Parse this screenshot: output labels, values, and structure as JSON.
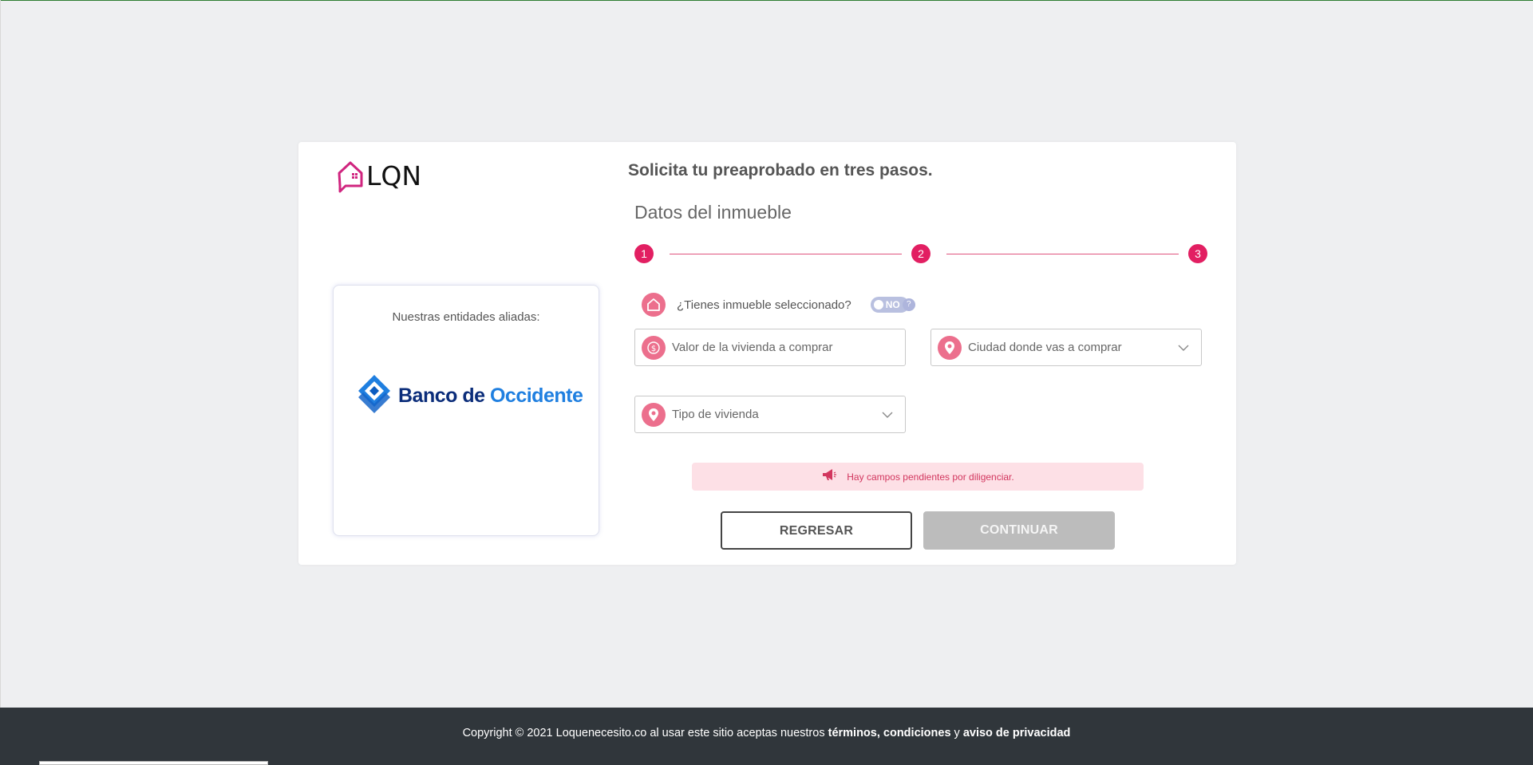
{
  "brand": {
    "logo_text": "LQN",
    "accent_color": "#e21f62"
  },
  "header": {
    "title": "Solicita tu preaprobado en tres pasos.",
    "subtitle": "Datos del inmueble"
  },
  "steps": [
    "1",
    "2",
    "3"
  ],
  "partners": {
    "title": "Nuestras entidades aliadas:",
    "bank": {
      "name_primary": "Banco de",
      "name_accent": "Occidente"
    }
  },
  "form": {
    "question": {
      "label": "¿Tienes inmueble seleccionado?",
      "toggle_value": "NO",
      "help": "?"
    },
    "fields": {
      "price": {
        "placeholder": "Valor de la vivienda a comprar",
        "icon": "dollar-icon"
      },
      "city": {
        "placeholder": "Ciudad donde vas a comprar",
        "icon": "location-pin-icon"
      },
      "type": {
        "placeholder": "Tipo de vivienda",
        "icon": "location-pin-icon"
      }
    },
    "alert": {
      "text": "Hay campos pendientes por diligenciar.",
      "icon": "megaphone-icon"
    }
  },
  "buttons": {
    "back": "REGRESAR",
    "continue": "CONTINUAR"
  },
  "footer": {
    "prefix": "Copyright © 2021 Loquenecesito.co al usar este sitio aceptas nuestros ",
    "terms": "términos, condiciones",
    "connector": " y ",
    "privacy": "aviso de privacidad"
  }
}
